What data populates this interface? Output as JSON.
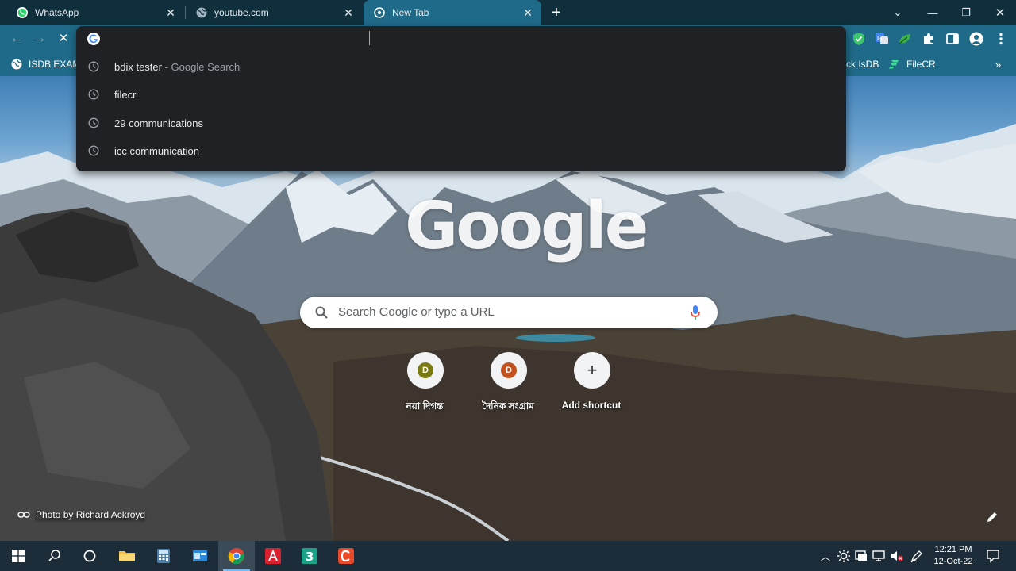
{
  "tabs": [
    {
      "title": "WhatsApp",
      "icon": "whatsapp-icon",
      "active": false
    },
    {
      "title": "youtube.com",
      "icon": "globe-icon",
      "active": false
    },
    {
      "title": "New Tab",
      "icon": "chrome-newtab-icon",
      "active": true
    }
  ],
  "bookmarks": {
    "left": "ISDB EXAM",
    "right1": "ck IsDB",
    "right2": "FileCR"
  },
  "omnibox": {
    "value": "",
    "suggestions": [
      {
        "text": "bdix tester",
        "sub": "- Google Search"
      },
      {
        "text": "filecr",
        "sub": ""
      },
      {
        "text": "29 communications",
        "sub": ""
      },
      {
        "text": "icc communication",
        "sub": ""
      }
    ]
  },
  "ntp": {
    "logo": "Google",
    "search_placeholder": "Search Google or type a URL",
    "shortcuts": [
      {
        "letter": "D",
        "label": "নয়া দিগন্ত",
        "color": "#7a7a12"
      },
      {
        "letter": "D",
        "label": "দৈনিক সংগ্রাম",
        "color": "#c1521d"
      }
    ],
    "add_shortcut": "Add shortcut",
    "attribution": "Photo by Richard Ackroyd"
  },
  "taskbar": {
    "time": "12:21 PM",
    "date": "12-Oct-22"
  },
  "colors": {
    "tab_strip": "#0f2f3d",
    "toolbar": "#1f6a88",
    "omnibox_bg": "#202124",
    "taskbar": "#1c2c38"
  }
}
